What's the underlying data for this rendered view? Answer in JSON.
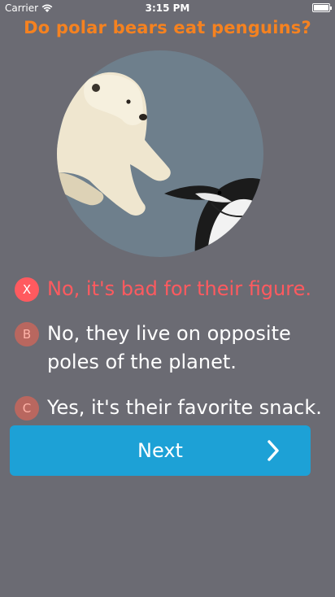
{
  "status_bar": {
    "carrier": "Carrier",
    "time": "3:15 PM"
  },
  "question": "Do polar bears eat penguins?",
  "answers": [
    {
      "badge": "X",
      "text": "No, it's bad for their figure.",
      "state": "wrong"
    },
    {
      "badge": "B",
      "text": "No, they live on opposite poles of the planet.",
      "state": "unselected"
    },
    {
      "badge": "C",
      "text": "Yes, it's their favorite snack.",
      "state": "unselected"
    }
  ],
  "next_button": {
    "label": "Next"
  },
  "colors": {
    "background": "#6b6b73",
    "question": "#f58220",
    "wrong": "#ff5a5f",
    "badge_muted": "#b9675f",
    "button": "#1da1d6"
  }
}
